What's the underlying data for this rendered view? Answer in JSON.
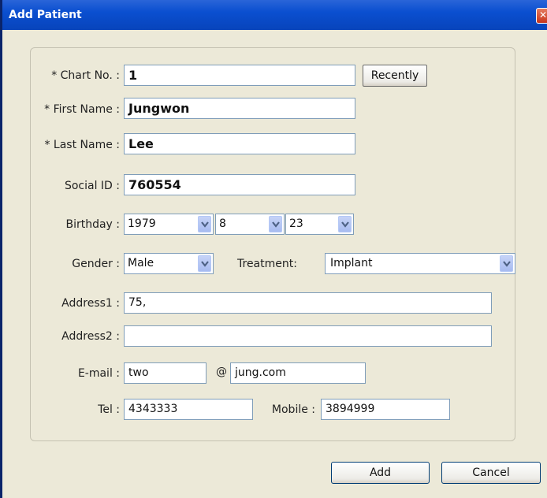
{
  "window": {
    "title": "Add Patient",
    "close_glyph": "✕"
  },
  "form": {
    "chart_no": {
      "label": "* Chart No. :",
      "value": "1",
      "button": "Recently"
    },
    "first_name": {
      "label": "* First Name :",
      "value": "Jungwon"
    },
    "last_name": {
      "label": "* Last Name :",
      "value": "Lee"
    },
    "social_id": {
      "label": "Social ID :",
      "value": "760554"
    },
    "birthday": {
      "label": "Birthday :",
      "year": "1979",
      "month": "8",
      "day": "23"
    },
    "gender": {
      "label": "Gender :",
      "value": "Male"
    },
    "treatment": {
      "label": "Treatment:",
      "value": "Implant"
    },
    "address1": {
      "label": "Address1 :",
      "value": "75,"
    },
    "address2": {
      "label": "Address2 :",
      "value": ""
    },
    "email": {
      "label": "E-mail :",
      "user": "two",
      "at": "@",
      "domain": "jung.com"
    },
    "tel": {
      "label": "Tel :",
      "value": "4343333"
    },
    "mobile": {
      "label": "Mobile :",
      "value": "3894999"
    }
  },
  "actions": {
    "add": "Add",
    "cancel": "Cancel"
  }
}
